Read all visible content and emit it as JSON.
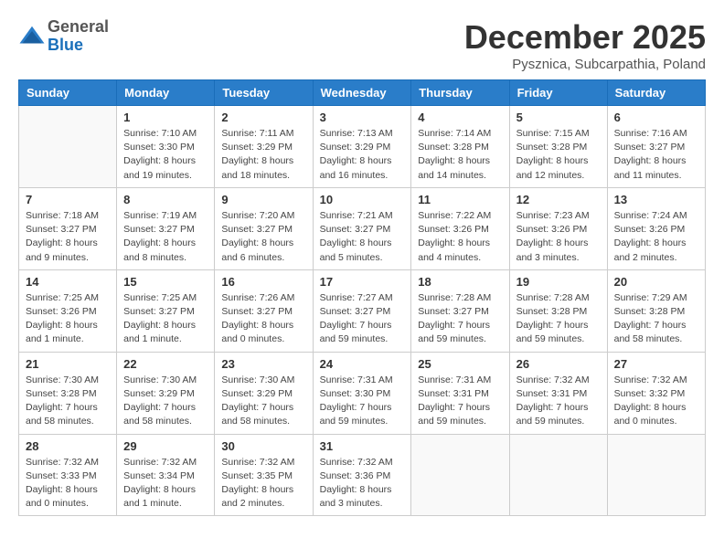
{
  "logo": {
    "general": "General",
    "blue": "Blue"
  },
  "title": "December 2025",
  "subtitle": "Pysznica, Subcarpathia, Poland",
  "days_of_week": [
    "Sunday",
    "Monday",
    "Tuesday",
    "Wednesday",
    "Thursday",
    "Friday",
    "Saturday"
  ],
  "weeks": [
    [
      {
        "day": "",
        "sunrise": "",
        "sunset": "",
        "daylight": ""
      },
      {
        "day": "1",
        "sunrise": "Sunrise: 7:10 AM",
        "sunset": "Sunset: 3:30 PM",
        "daylight": "Daylight: 8 hours and 19 minutes."
      },
      {
        "day": "2",
        "sunrise": "Sunrise: 7:11 AM",
        "sunset": "Sunset: 3:29 PM",
        "daylight": "Daylight: 8 hours and 18 minutes."
      },
      {
        "day": "3",
        "sunrise": "Sunrise: 7:13 AM",
        "sunset": "Sunset: 3:29 PM",
        "daylight": "Daylight: 8 hours and 16 minutes."
      },
      {
        "day": "4",
        "sunrise": "Sunrise: 7:14 AM",
        "sunset": "Sunset: 3:28 PM",
        "daylight": "Daylight: 8 hours and 14 minutes."
      },
      {
        "day": "5",
        "sunrise": "Sunrise: 7:15 AM",
        "sunset": "Sunset: 3:28 PM",
        "daylight": "Daylight: 8 hours and 12 minutes."
      },
      {
        "day": "6",
        "sunrise": "Sunrise: 7:16 AM",
        "sunset": "Sunset: 3:27 PM",
        "daylight": "Daylight: 8 hours and 11 minutes."
      }
    ],
    [
      {
        "day": "7",
        "sunrise": "Sunrise: 7:18 AM",
        "sunset": "Sunset: 3:27 PM",
        "daylight": "Daylight: 8 hours and 9 minutes."
      },
      {
        "day": "8",
        "sunrise": "Sunrise: 7:19 AM",
        "sunset": "Sunset: 3:27 PM",
        "daylight": "Daylight: 8 hours and 8 minutes."
      },
      {
        "day": "9",
        "sunrise": "Sunrise: 7:20 AM",
        "sunset": "Sunset: 3:27 PM",
        "daylight": "Daylight: 8 hours and 6 minutes."
      },
      {
        "day": "10",
        "sunrise": "Sunrise: 7:21 AM",
        "sunset": "Sunset: 3:27 PM",
        "daylight": "Daylight: 8 hours and 5 minutes."
      },
      {
        "day": "11",
        "sunrise": "Sunrise: 7:22 AM",
        "sunset": "Sunset: 3:26 PM",
        "daylight": "Daylight: 8 hours and 4 minutes."
      },
      {
        "day": "12",
        "sunrise": "Sunrise: 7:23 AM",
        "sunset": "Sunset: 3:26 PM",
        "daylight": "Daylight: 8 hours and 3 minutes."
      },
      {
        "day": "13",
        "sunrise": "Sunrise: 7:24 AM",
        "sunset": "Sunset: 3:26 PM",
        "daylight": "Daylight: 8 hours and 2 minutes."
      }
    ],
    [
      {
        "day": "14",
        "sunrise": "Sunrise: 7:25 AM",
        "sunset": "Sunset: 3:26 PM",
        "daylight": "Daylight: 8 hours and 1 minute."
      },
      {
        "day": "15",
        "sunrise": "Sunrise: 7:25 AM",
        "sunset": "Sunset: 3:27 PM",
        "daylight": "Daylight: 8 hours and 1 minute."
      },
      {
        "day": "16",
        "sunrise": "Sunrise: 7:26 AM",
        "sunset": "Sunset: 3:27 PM",
        "daylight": "Daylight: 8 hours and 0 minutes."
      },
      {
        "day": "17",
        "sunrise": "Sunrise: 7:27 AM",
        "sunset": "Sunset: 3:27 PM",
        "daylight": "Daylight: 7 hours and 59 minutes."
      },
      {
        "day": "18",
        "sunrise": "Sunrise: 7:28 AM",
        "sunset": "Sunset: 3:27 PM",
        "daylight": "Daylight: 7 hours and 59 minutes."
      },
      {
        "day": "19",
        "sunrise": "Sunrise: 7:28 AM",
        "sunset": "Sunset: 3:28 PM",
        "daylight": "Daylight: 7 hours and 59 minutes."
      },
      {
        "day": "20",
        "sunrise": "Sunrise: 7:29 AM",
        "sunset": "Sunset: 3:28 PM",
        "daylight": "Daylight: 7 hours and 58 minutes."
      }
    ],
    [
      {
        "day": "21",
        "sunrise": "Sunrise: 7:30 AM",
        "sunset": "Sunset: 3:28 PM",
        "daylight": "Daylight: 7 hours and 58 minutes."
      },
      {
        "day": "22",
        "sunrise": "Sunrise: 7:30 AM",
        "sunset": "Sunset: 3:29 PM",
        "daylight": "Daylight: 7 hours and 58 minutes."
      },
      {
        "day": "23",
        "sunrise": "Sunrise: 7:30 AM",
        "sunset": "Sunset: 3:29 PM",
        "daylight": "Daylight: 7 hours and 58 minutes."
      },
      {
        "day": "24",
        "sunrise": "Sunrise: 7:31 AM",
        "sunset": "Sunset: 3:30 PM",
        "daylight": "Daylight: 7 hours and 59 minutes."
      },
      {
        "day": "25",
        "sunrise": "Sunrise: 7:31 AM",
        "sunset": "Sunset: 3:31 PM",
        "daylight": "Daylight: 7 hours and 59 minutes."
      },
      {
        "day": "26",
        "sunrise": "Sunrise: 7:32 AM",
        "sunset": "Sunset: 3:31 PM",
        "daylight": "Daylight: 7 hours and 59 minutes."
      },
      {
        "day": "27",
        "sunrise": "Sunrise: 7:32 AM",
        "sunset": "Sunset: 3:32 PM",
        "daylight": "Daylight: 8 hours and 0 minutes."
      }
    ],
    [
      {
        "day": "28",
        "sunrise": "Sunrise: 7:32 AM",
        "sunset": "Sunset: 3:33 PM",
        "daylight": "Daylight: 8 hours and 0 minutes."
      },
      {
        "day": "29",
        "sunrise": "Sunrise: 7:32 AM",
        "sunset": "Sunset: 3:34 PM",
        "daylight": "Daylight: 8 hours and 1 minute."
      },
      {
        "day": "30",
        "sunrise": "Sunrise: 7:32 AM",
        "sunset": "Sunset: 3:35 PM",
        "daylight": "Daylight: 8 hours and 2 minutes."
      },
      {
        "day": "31",
        "sunrise": "Sunrise: 7:32 AM",
        "sunset": "Sunset: 3:36 PM",
        "daylight": "Daylight: 8 hours and 3 minutes."
      },
      {
        "day": "",
        "sunrise": "",
        "sunset": "",
        "daylight": ""
      },
      {
        "day": "",
        "sunrise": "",
        "sunset": "",
        "daylight": ""
      },
      {
        "day": "",
        "sunrise": "",
        "sunset": "",
        "daylight": ""
      }
    ]
  ]
}
